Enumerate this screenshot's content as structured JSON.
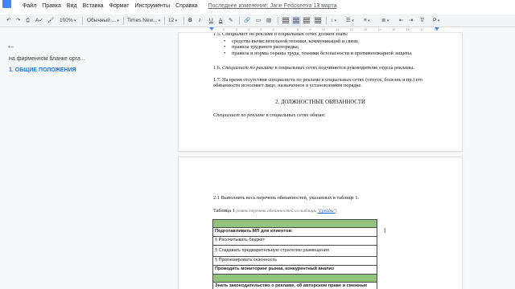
{
  "menu": {
    "items": [
      "Файл",
      "Правка",
      "Вид",
      "Вставка",
      "Формат",
      "Инструменты",
      "Справка"
    ],
    "last_edit": "Последнее изменение: Jane Fedoseeva 13 марта"
  },
  "toolbar": {
    "zoom": "100%",
    "style": "Обычный ...",
    "font": "Times New...",
    "size": "12",
    "text_color_glyph": "A",
    "bold": "B",
    "italic": "I",
    "underline": "U",
    "pen": "P"
  },
  "ruler": {
    "ticks": [
      "1",
      "2",
      "3",
      "4",
      "5",
      "6",
      "7",
      "8",
      "9",
      "10",
      "11",
      "12",
      "13",
      "14",
      "15",
      "16",
      "17",
      "18"
    ]
  },
  "outline": {
    "items": [
      {
        "label": "на фирменном бланке орга..."
      },
      {
        "label": "1. ОБЩИЕ ПОЛОЖЕНИЯ"
      }
    ]
  },
  "page1": {
    "bullets": [
      "средства вычислительной техники, коммуникаций и связи;",
      "правила трудового распорядка;",
      "правила и нормы охраны труда, техники безопасности и противопожарной защиты."
    ],
    "p16_italic": "Специалист по рекламе",
    "p16_rest": " в социальных сетях подчиняется руководителю отдела рекламы.",
    "p16_num": "1.6. ",
    "p17": "1.7. На время отсутствия специалиста по рекламе в социальных сетях (отпуск, болезнь и пр.) его обязанности исполняет лицо, назначенное в установленном порядке.",
    "section2": "2. ДОЛЖНОСТНЫЕ ОБЯЗАННОСТИ",
    "duties_italic": "Специалист по рекламе",
    "duties_rest": " в социальных сетях обязан:"
  },
  "page2": {
    "p21": "2.1 Выполнять весь перечень обязанностей, указанных в таблице 1.",
    "table_caption": "Таблица 1",
    "table_note_open": " (взять перечень обязанностей из таблицы ",
    "table_note_link": "\"Грейды\"",
    "table_note_close": ")",
    "table_rows": [
      {
        "text": "",
        "kind": "green"
      },
      {
        "text": "Подготавливать МП для клиентов:",
        "kind": "bold"
      },
      {
        "text": "§ Рассчитывать бюджет",
        "kind": "normal"
      },
      {
        "text": "§ Создавать предварительную стратегию размещения",
        "kind": "tall"
      },
      {
        "text": "§ Прогнозировать сезонность",
        "kind": "normal"
      },
      {
        "text": "Проводить мониторинг рынка, конкурентный анализ",
        "kind": "bold"
      },
      {
        "text": "",
        "kind": "green"
      },
      {
        "text": "Знать законодательство о рекламе, об авторском праве и смежных",
        "kind": "bold"
      }
    ]
  },
  "colors": {
    "accent": "#1a73e8",
    "table_header_fill": "#93c47d",
    "page_bg": "#f8f9fa"
  }
}
